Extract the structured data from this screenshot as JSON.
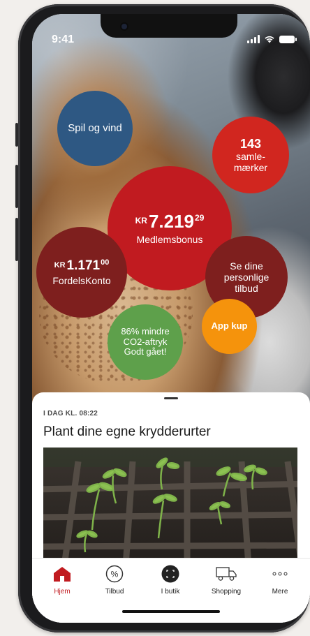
{
  "status": {
    "time": "9:41"
  },
  "bubbles": {
    "spil": {
      "label": "Spil og vind"
    },
    "samle": {
      "count": "143",
      "label_line1": "samle-",
      "label_line2": "mærker"
    },
    "bonus": {
      "currency": "KR",
      "main": "7.219",
      "decimals": "29",
      "label": "Medlemsbonus"
    },
    "fordels": {
      "currency": "KR",
      "main": "1.171",
      "decimals": "00",
      "label": "FordelsKonto"
    },
    "tilbud": {
      "line1": "Se dine",
      "line2": "personlige",
      "line3": "tilbud"
    },
    "co2": {
      "line1": "86% mindre",
      "line2": "CO2-aftryk",
      "line3": "Godt gået!"
    },
    "appkup": {
      "label": "App kup"
    }
  },
  "article": {
    "meta": "I DAG KL. 08:22",
    "title": "Plant dine egne krydderurter"
  },
  "tabbar": {
    "items": [
      {
        "label": "Hjem",
        "icon": "home-icon",
        "active": true
      },
      {
        "label": "Tilbud",
        "icon": "percent-icon"
      },
      {
        "label": "I butik",
        "icon": "scan-icon"
      },
      {
        "label": "Shopping",
        "icon": "truck-icon"
      },
      {
        "label": "Mere",
        "icon": "more-icon"
      }
    ]
  },
  "colors": {
    "accent_red": "#c11b20",
    "bright_red": "#d1261f",
    "dark_red": "#7e1f1e",
    "blue": "#2e5883",
    "green": "#5ea04b",
    "orange": "#f5930c"
  }
}
